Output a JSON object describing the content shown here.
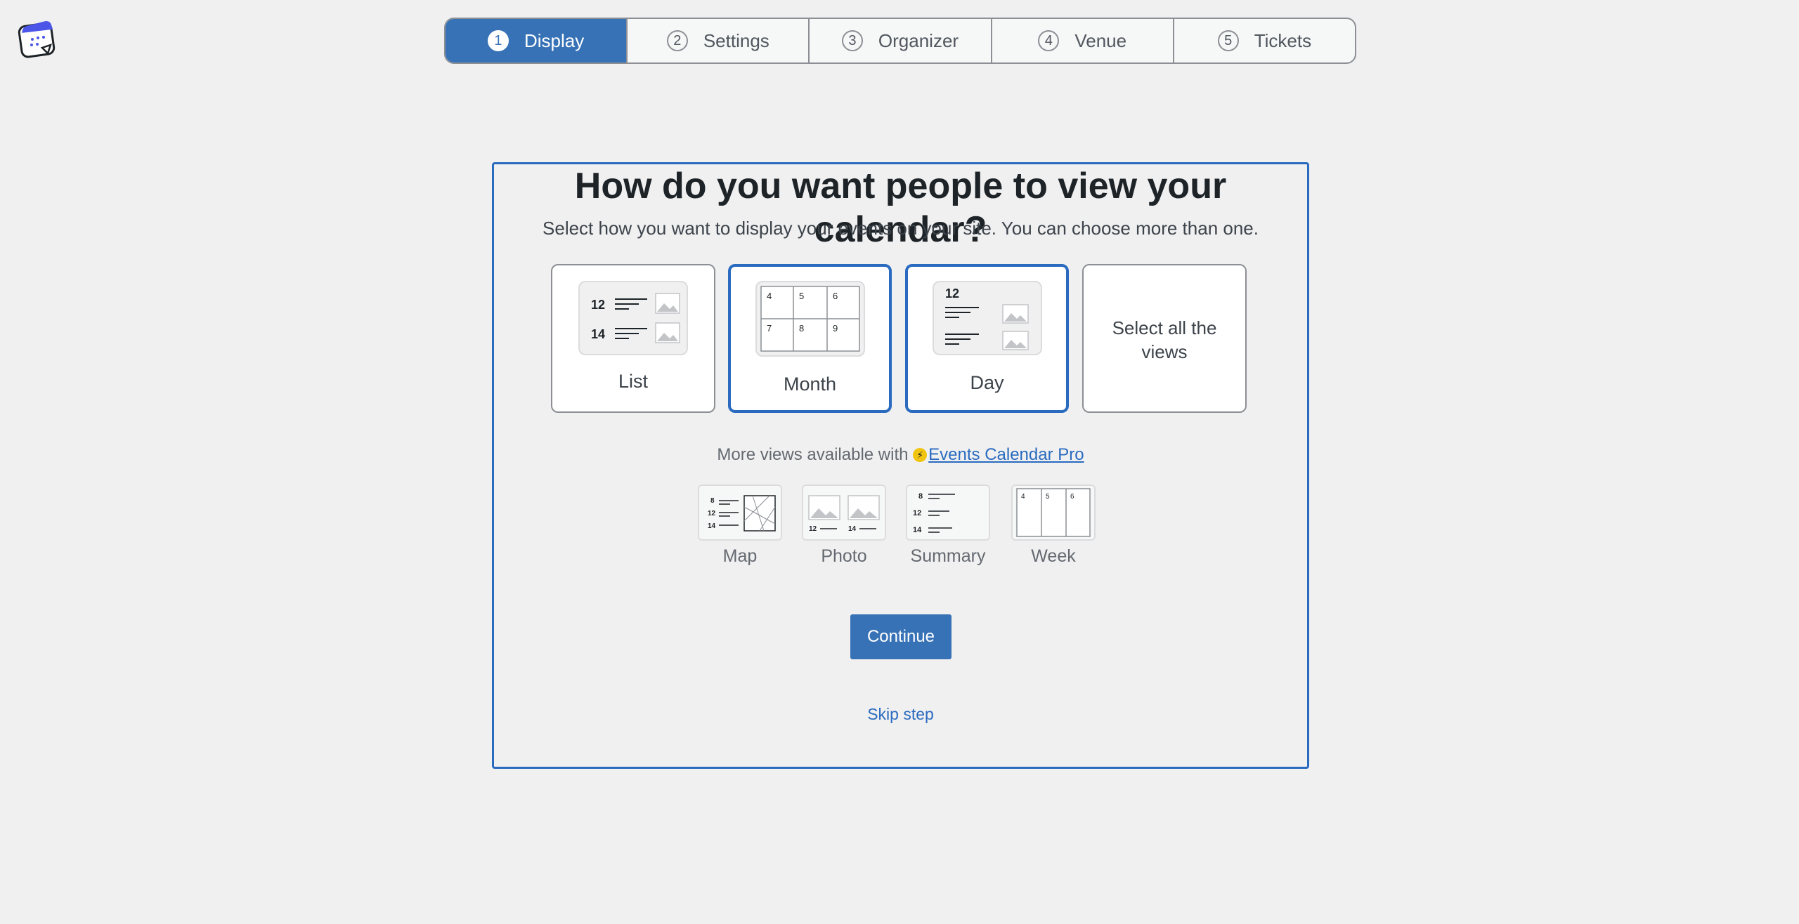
{
  "stepper": {
    "steps": [
      {
        "number": "1",
        "label": "Display"
      },
      {
        "number": "2",
        "label": "Settings"
      },
      {
        "number": "3",
        "label": "Organizer"
      },
      {
        "number": "4",
        "label": "Venue"
      },
      {
        "number": "5",
        "label": "Tickets"
      }
    ],
    "active_index": 0
  },
  "main": {
    "title": "How do you want people to view your calendar?",
    "subtitle": "Select how you want to display your events on your site. You can choose more than one.",
    "views": [
      {
        "label": "List",
        "selected": false,
        "icon": "list-view-icon"
      },
      {
        "label": "Month",
        "selected": true,
        "icon": "month-view-icon"
      },
      {
        "label": "Day",
        "selected": true,
        "icon": "day-view-icon"
      },
      {
        "label": "Select all the views",
        "selected": false
      }
    ],
    "thumbs": {
      "list_numbers": [
        "12",
        "14"
      ],
      "month_numbers": [
        "4",
        "5",
        "6",
        "7",
        "8",
        "9"
      ],
      "day_number": "12"
    },
    "pro": {
      "text": "More views available with",
      "link": "Events Calendar Pro",
      "icon": "bolt-icon",
      "views": [
        {
          "label": "Map",
          "numbers": [
            "8",
            "12",
            "14"
          ]
        },
        {
          "label": "Photo",
          "numbers": [
            "12",
            "14"
          ]
        },
        {
          "label": "Summary",
          "numbers": [
            "8",
            "12",
            "14"
          ]
        },
        {
          "label": "Week",
          "numbers": [
            "4",
            "5",
            "6"
          ]
        }
      ]
    },
    "continue_label": "Continue",
    "skip_label": "Skip step"
  },
  "colors": {
    "accent": "#3772b6",
    "selected_border": "#2a6bbf",
    "background": "#f0f0f1"
  }
}
